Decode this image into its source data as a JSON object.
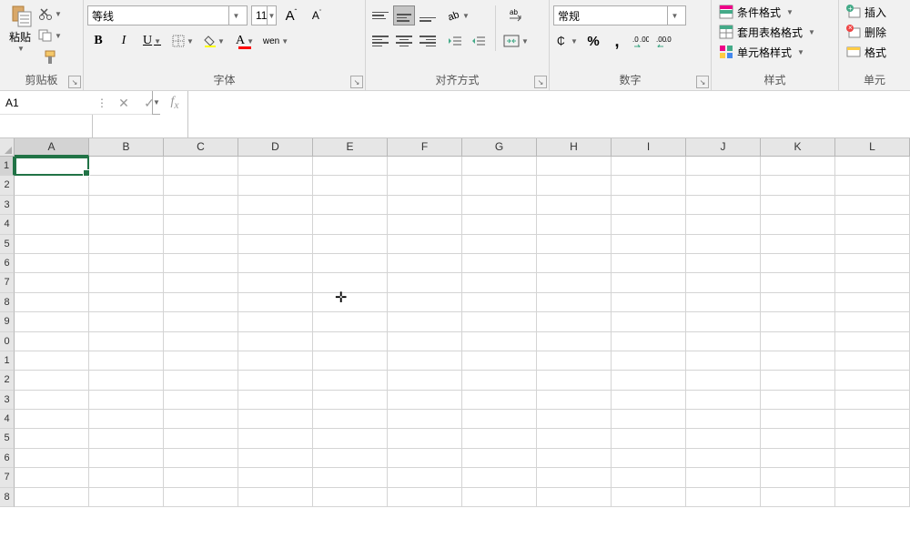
{
  "ribbon": {
    "clipboard": {
      "label": "剪贴板",
      "paste": "粘贴"
    },
    "font": {
      "label": "字体",
      "name": "等线",
      "size": "11",
      "inc_label": "A",
      "dec_label": "A",
      "bold": "B",
      "italic": "I",
      "underline": "U",
      "wen": "wen"
    },
    "alignment": {
      "label": "对齐方式",
      "wrap": "ab"
    },
    "number": {
      "label": "数字",
      "format": "常规"
    },
    "styles": {
      "label": "样式",
      "conditional": "条件格式",
      "table": "套用表格格式",
      "cell": "单元格样式"
    },
    "cells": {
      "label": "单元",
      "insert": "插入",
      "delete": "删除",
      "format": "格式"
    }
  },
  "namebox": "A1",
  "columns": [
    "A",
    "B",
    "C",
    "D",
    "E",
    "F",
    "G",
    "H",
    "I",
    "J",
    "K",
    "L"
  ],
  "rows": [
    "1",
    "2",
    "3",
    "4",
    "5",
    "6",
    "7",
    "8",
    "9",
    "0",
    "1",
    "2",
    "3",
    "4",
    "5",
    "6",
    "7",
    "8"
  ]
}
